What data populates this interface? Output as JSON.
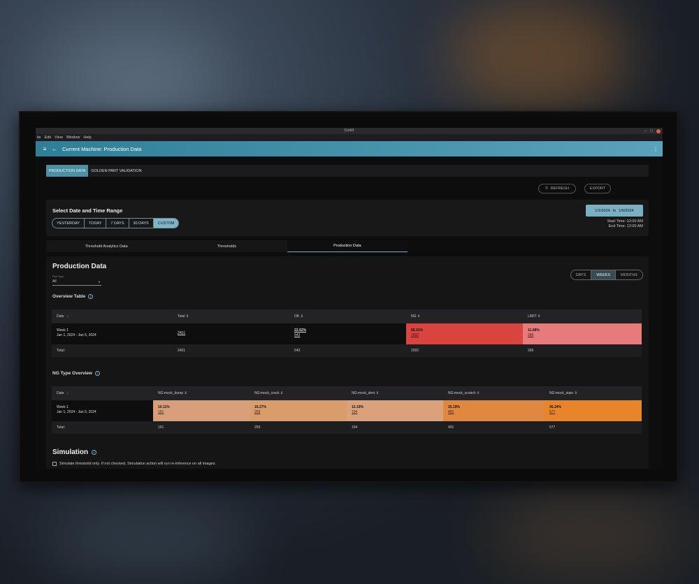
{
  "window": {
    "title": "CortiX",
    "controls": [
      "–",
      "□"
    ]
  },
  "menu": [
    "ile",
    "Edit",
    "View",
    "Window",
    "Help"
  ],
  "appbar": {
    "title": "Current Machine: Production Data"
  },
  "top_tabs": [
    {
      "label": "PRODUCTION DATA",
      "active": true
    },
    {
      "label": "GOLDEN PART VALIDATION",
      "active": false
    }
  ],
  "actions": {
    "refresh": "REFRESH",
    "export": "EXPORT"
  },
  "date_range": {
    "title": "Select Date and Time Range",
    "options": [
      "YESTERDAY",
      "TODAY",
      "7 DAYS",
      "30 DAYS",
      "CUSTOM"
    ],
    "selected": "CUSTOM",
    "from": "1/1/2024",
    "to_label": "to",
    "to": "1/6/2024",
    "start_time": "Start Time: 12:00 AM",
    "end_time": "End Time: 12:00 AM"
  },
  "sub_tabs": [
    "Threshold Analytics Data",
    "Thresholds",
    "Production Data"
  ],
  "production": {
    "title": "Production Data",
    "part_type_label": "Part Type",
    "part_type_value": "All",
    "granularity": [
      "DAYS",
      "WEEKS",
      "MONTHS"
    ],
    "granularity_selected": "WEEKS"
  },
  "overview": {
    "title": "Overview Table",
    "headers": [
      "Date",
      "Total",
      "OK",
      "NG",
      "LIMIT"
    ],
    "row": {
      "week": "Week 1",
      "range": "Jan 1, 2024 - Jan 5, 2024",
      "total": "2401",
      "ok_pct": "22.62%",
      "ok": "543",
      "ng_pct": "66.31%",
      "ng": "1592",
      "limit_pct": "11.08%",
      "limit": "266"
    },
    "footer": {
      "label": "Total:",
      "total": "2401",
      "ok": "543",
      "ng": "1592",
      "limit": "266"
    }
  },
  "ng_types": {
    "title": "NG Type Overview",
    "headers": [
      "Date",
      "NG:mock_bump",
      "NG:mock_crack",
      "NG:mock_dent",
      "NG:mock_scratch",
      "NG:mock_stain"
    ],
    "row": {
      "week": "Week 1",
      "range": "Jan 1, 2024 - Jan 5, 2024",
      "cells": [
        {
          "pct": "10.11%",
          "count": "161"
        },
        {
          "pct": "16.27%",
          "count": "259"
        },
        {
          "pct": "12.19%",
          "count": "194"
        },
        {
          "pct": "25.19%",
          "count": "401"
        },
        {
          "pct": "36.24%",
          "count": "577"
        }
      ]
    },
    "footer": {
      "label": "Total:",
      "values": [
        "161",
        "259",
        "194",
        "401",
        "577"
      ]
    }
  },
  "simulation": {
    "title": "Simulation",
    "checkbox_label": "Simulate threshold only. If not checked, Simulation action will run re-inference on all images."
  },
  "colors": {
    "accent": "#5aa2bb",
    "ng": "#d9443f",
    "limit": "#e77b7b",
    "bump": "#d8a07a",
    "crack": "#d99d6c",
    "dent": "#d9a27a",
    "scratch": "#e08840",
    "stain": "#e8852a"
  }
}
